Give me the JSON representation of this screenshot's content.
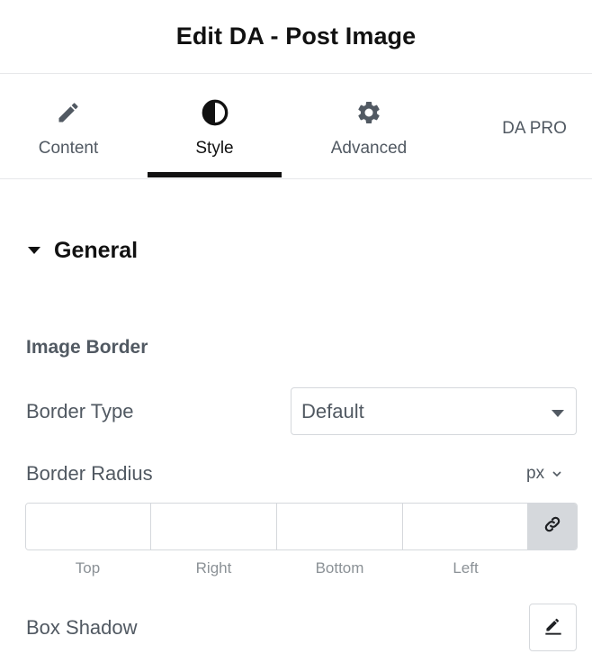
{
  "header": {
    "title": "Edit DA - Post Image"
  },
  "tabs": [
    {
      "label": "Content",
      "icon": "pencil-icon"
    },
    {
      "label": "Style",
      "icon": "contrast-icon",
      "active": true
    },
    {
      "label": "Advanced",
      "icon": "gear-icon"
    },
    {
      "label": "DA PRO"
    }
  ],
  "section": {
    "title": "General",
    "expanded": true
  },
  "image_border": {
    "heading": "Image Border",
    "border_type": {
      "label": "Border Type",
      "value": "Default"
    },
    "border_radius": {
      "label": "Border Radius",
      "unit": "px",
      "fields": [
        {
          "label": "Top",
          "value": ""
        },
        {
          "label": "Right",
          "value": ""
        },
        {
          "label": "Bottom",
          "value": ""
        },
        {
          "label": "Left",
          "value": ""
        }
      ],
      "link_icon": "link-icon"
    },
    "box_shadow": {
      "label": "Box Shadow",
      "edit_icon": "pencil-edit-icon"
    }
  },
  "colors": {
    "text": "#515962",
    "title": "#111111",
    "border": "#d5d8dc",
    "link_bg": "#d5d8dc"
  }
}
